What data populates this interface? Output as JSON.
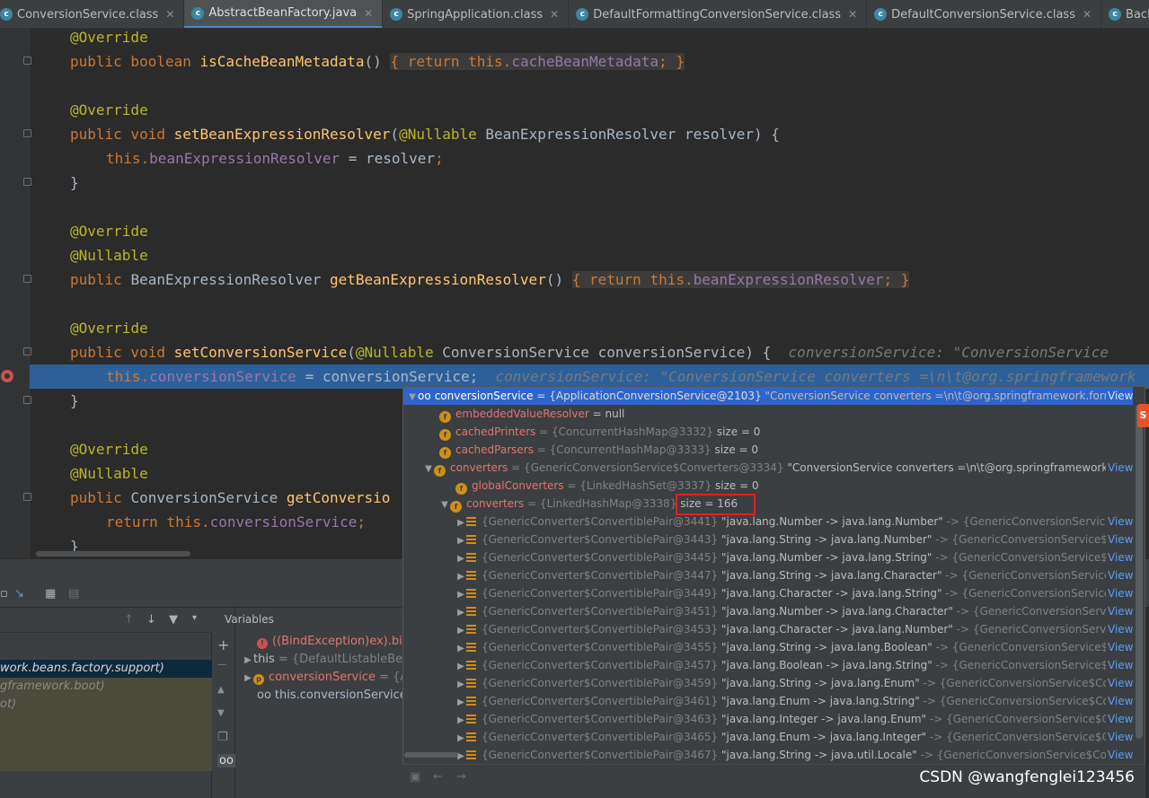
{
  "tabs": [
    {
      "label": "ConversionService.class",
      "active": false
    },
    {
      "label": "AbstractBeanFactory.java",
      "active": true
    },
    {
      "label": "SpringApplication.class",
      "active": false
    },
    {
      "label": "DefaultFormattingConversionService.class",
      "active": false
    },
    {
      "label": "DefaultConversionService.class",
      "active": false
    },
    {
      "label": "BackgroundPreinitializer.class",
      "active": false
    }
  ],
  "code": {
    "l1": "@Override",
    "l2_kw": "public boolean ",
    "l2_fn": "isCacheBeanMetadata",
    "l2_rest": "() ",
    "l2_body_kw": "{ return ",
    "l2_body_this": "this.",
    "l2_body_fld": "cacheBeanMetadata",
    "l2_body_end": "; }",
    "l3": "@Override",
    "l4_kw": "public void ",
    "l4_fn": "setBeanExpressionResolver",
    "l4_p1": "(",
    "l4_ann": "@Nullable",
    "l4_rest": " BeanExpressionResolver resolver) {",
    "l5_this": "this.",
    "l5_fld": "beanExpressionResolver",
    "l5_rest": " = resolver",
    "l5_semi": ";",
    "l6": "}",
    "l7": "@Override",
    "l8": "@Nullable",
    "l9_kw": "public ",
    "l9_type": "BeanExpressionResolver ",
    "l9_fn": "getBeanExpressionResolver",
    "l9_rest": "() ",
    "l9_body_kw": "{ return ",
    "l9_body_this": "this.",
    "l9_body_fld": "beanExpressionResolver",
    "l9_body_end": "; }",
    "l10": "@Override",
    "l11_kw": "public void ",
    "l11_fn": "setConversionService",
    "l11_p1": "(",
    "l11_ann": "@Nullable",
    "l11_rest": " ConversionService conversionService) {",
    "l11_hint": "conversionService: \"ConversionService",
    "l12_this": "this.",
    "l12_fld": "conversionService",
    "l12_rest": " = conversionService;",
    "l12_hint": "conversionService: \"ConversionService converters =\\n\\t@org.springframework",
    "l13": "}",
    "l14": "@Override",
    "l15": "@Nullable",
    "l16_kw": "public ",
    "l16_rest": "ConversionService ",
    "l16_fn": "getConversio",
    "l17_kw": "return ",
    "l17_this": "this.",
    "l17_fld": "conversionService",
    "l17_semi": ";",
    "l18": "}"
  },
  "frames": [
    {
      "label": "work.beans.factory.support)",
      "selected": true
    },
    {
      "label": "gframework.boot)",
      "selected": false
    },
    {
      "label": "ot)",
      "selected": false
    }
  ],
  "variables": {
    "header": "Variables",
    "rows": [
      {
        "name": "((BindException)ex).bindi",
        "type": ""
      },
      {
        "name": "this",
        "type": " = {DefaultListableBe"
      },
      {
        "name": "conversionService",
        "type": " = {Ap"
      },
      {
        "name": "this.conversionService",
        "type": " ="
      }
    ]
  },
  "popup": {
    "view_label": "View",
    "root": {
      "name": "conversionService",
      "type": " = {ApplicationConversionService@2103}",
      "value": " \"ConversionService converters =\\n\\t@org.springframework.format.a..."
    },
    "fields": [
      {
        "name": "embeddedValueResolver",
        "type": "",
        "value": " = null"
      },
      {
        "name": "cachedPrinters",
        "type": " = {ConcurrentHashMap@3332}",
        "value": "  size = 0"
      },
      {
        "name": "cachedParsers",
        "type": " = {ConcurrentHashMap@3333}",
        "value": "  size = 0"
      },
      {
        "name": "converters",
        "type": " = {GenericConversionService$Converters@3334}",
        "value": " \"ConversionService converters =\\n\\t@org.springframework.form..."
      }
    ],
    "globalConverters": {
      "name": "globalConverters",
      "type": " = {LinkedHashSet@3337}",
      "value": "  size = 0"
    },
    "convertersMap": {
      "name": "converters",
      "type": " = {LinkedHashMap@3338}",
      "value": " size = 166"
    },
    "pairs": [
      {
        "id": "{GenericConverter$ConvertiblePair@3441}",
        "value": " \"java.lang.Number -> java.lang.Number\"",
        "tail": " -> {GenericConversionService$Cor..."
      },
      {
        "id": "{GenericConverter$ConvertiblePair@3443}",
        "value": " \"java.lang.String -> java.lang.Number\"",
        "tail": " -> {GenericConversionService$Conve..."
      },
      {
        "id": "{GenericConverter$ConvertiblePair@3445}",
        "value": " \"java.lang.Number -> java.lang.String\"",
        "tail": " -> {GenericConversionService$Conve..."
      },
      {
        "id": "{GenericConverter$ConvertiblePair@3447}",
        "value": " \"java.lang.String -> java.lang.Character\"",
        "tail": " -> {GenericConversionService$Conv..."
      },
      {
        "id": "{GenericConverter$ConvertiblePair@3449}",
        "value": " \"java.lang.Character -> java.lang.String\"",
        "tail": " -> {GenericConversionService$Con..."
      },
      {
        "id": "{GenericConverter$ConvertiblePair@3451}",
        "value": " \"java.lang.Number -> java.lang.Character\"",
        "tail": " -> {GenericConversionService$Co..."
      },
      {
        "id": "{GenericConverter$ConvertiblePair@3453}",
        "value": " \"java.lang.Character -> java.lang.Number\"",
        "tail": " -> {GenericConversionService$Co..."
      },
      {
        "id": "{GenericConverter$ConvertiblePair@3455}",
        "value": " \"java.lang.String -> java.lang.Boolean\"",
        "tail": " -> {GenericConversionService$Conve..."
      },
      {
        "id": "{GenericConverter$ConvertiblePair@3457}",
        "value": " \"java.lang.Boolean -> java.lang.String\"",
        "tail": " -> {GenericConversionService$Conve..."
      },
      {
        "id": "{GenericConverter$ConvertiblePair@3459}",
        "value": " \"java.lang.String -> java.lang.Enum\"",
        "tail": " -> {GenericConversionService$Converte..."
      },
      {
        "id": "{GenericConverter$ConvertiblePair@3461}",
        "value": " \"java.lang.Enum -> java.lang.String\"",
        "tail": " -> {GenericConversionService$Converte..."
      },
      {
        "id": "{GenericConverter$ConvertiblePair@3463}",
        "value": " \"java.lang.Integer -> java.lang.Enum\"",
        "tail": " -> {GenericConversionService$Conver..."
      },
      {
        "id": "{GenericConverter$ConvertiblePair@3465}",
        "value": " \"java.lang.Enum -> java.lang.Integer\"",
        "tail": " -> {GenericConversionService$Conver..."
      },
      {
        "id": "{GenericConverter$ConvertiblePair@3467}",
        "value": " \"java.lang.String -> java.util.Locale\"",
        "tail": " -> {GenericConversionService$Converte..."
      }
    ]
  },
  "watermark": "CSDN @wangfenglei123456",
  "colors": {
    "accent": "#2f65ca",
    "highlight_box": "#e02020",
    "exec_line": "#2d6099"
  }
}
